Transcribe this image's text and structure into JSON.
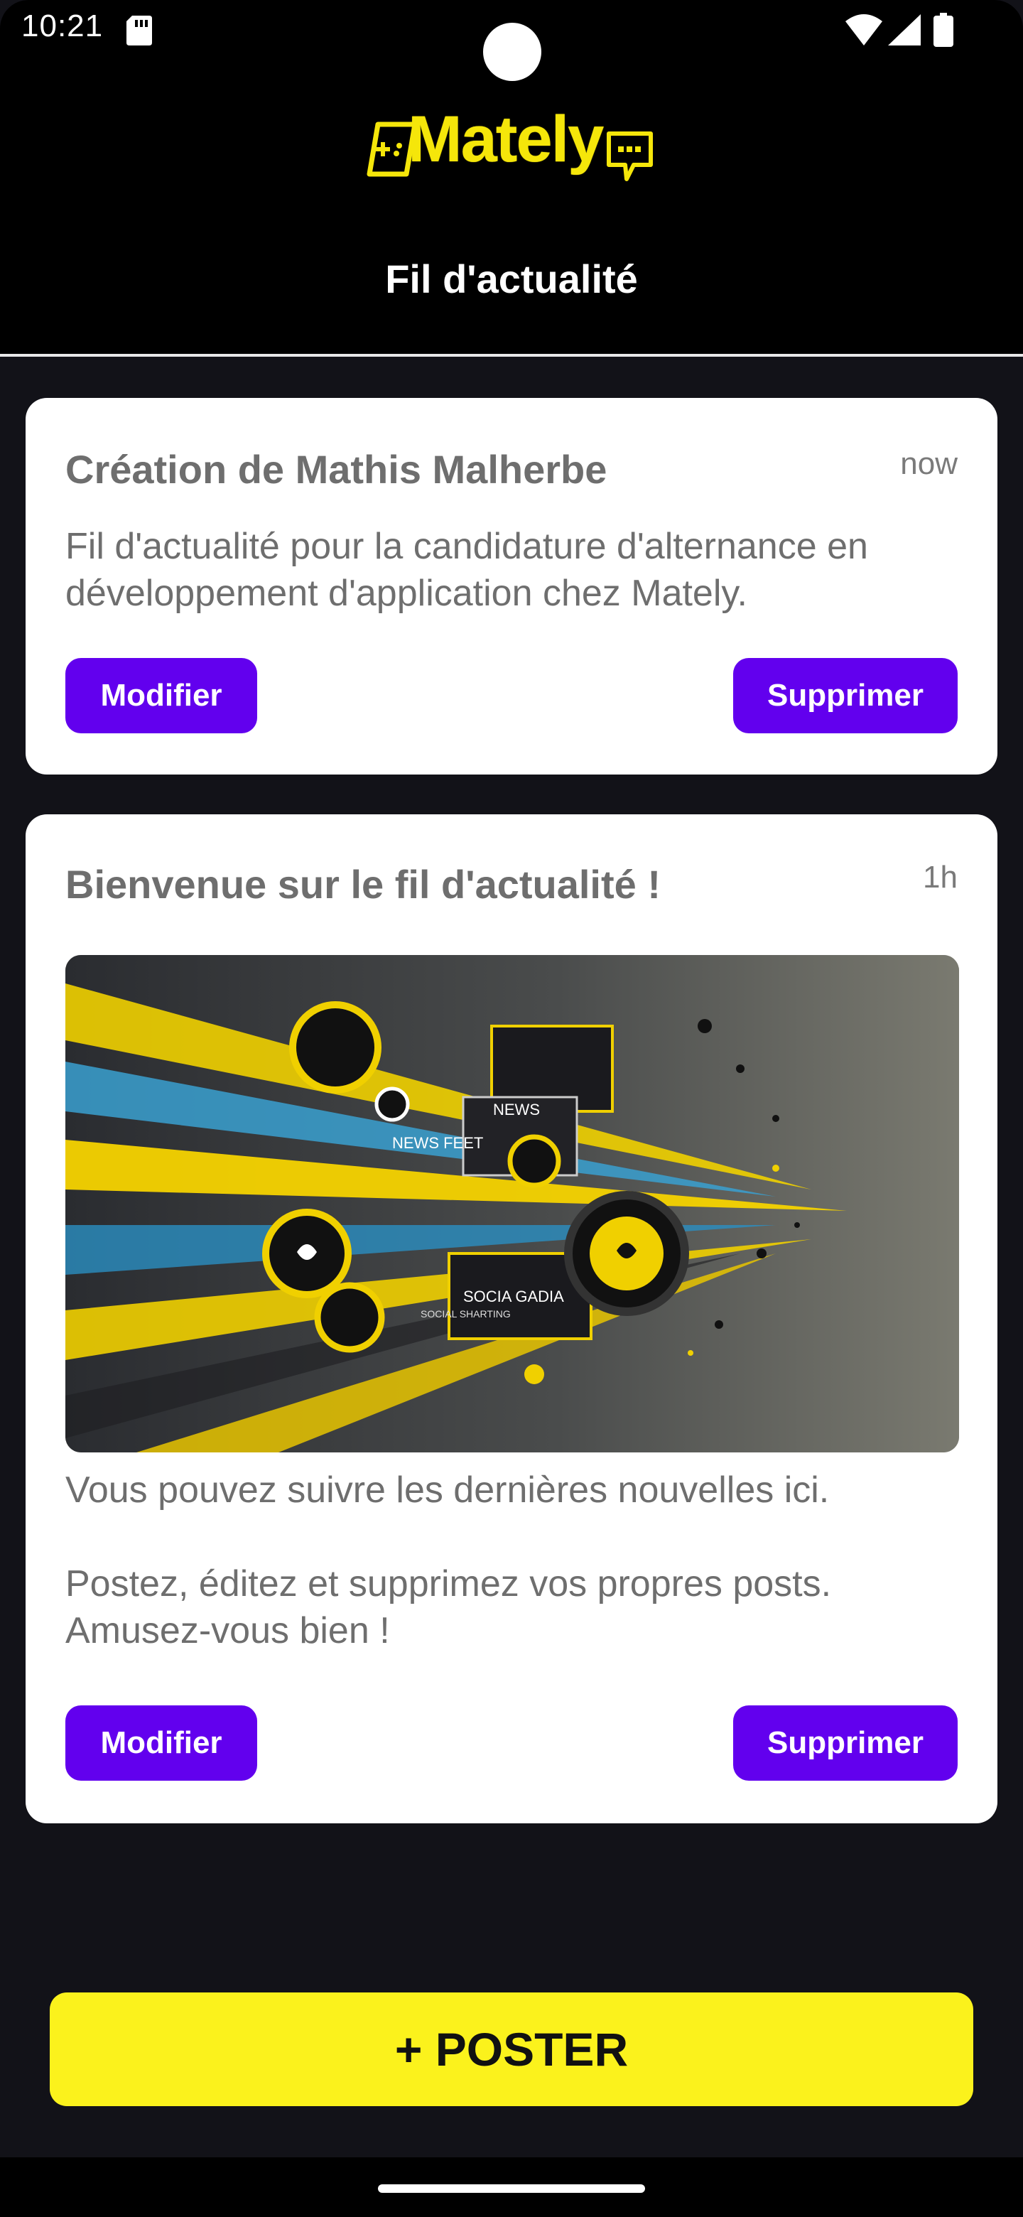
{
  "status_bar": {
    "time": "10:21",
    "icons": [
      "sd-card-icon",
      "wifi-icon",
      "signal-icon",
      "battery-icon"
    ]
  },
  "header": {
    "logo_text": "Mately",
    "title": "Fil d'actualité"
  },
  "posts": [
    {
      "title": "Création de Mathis Malherbe",
      "time": "now",
      "body": "Fil d'actualité pour la candidature d'alternance en développement d'application chez Mately.",
      "edit_label": "Modifier",
      "delete_label": "Supprimer"
    },
    {
      "title": "Bienvenue sur le fil d'actualité !",
      "time": "1h",
      "image_text": [
        "NEWS",
        "NEWS FEET",
        "SOCIA GADIA",
        "SOCIAL SHARTING"
      ],
      "body_line_1": "Vous pouvez suivre les dernières nouvelles ici.",
      "body_line_2": "Postez, éditez et supprimez vos propres posts. Amusez-vous bien !",
      "edit_label": "Modifier",
      "delete_label": "Supprimer"
    }
  ],
  "poster_button_label": "+ POSTER",
  "colors": {
    "background": "#121218",
    "accent_yellow": "#fbf21c",
    "button_purple": "#6200ee",
    "card_text": "#6e6e6e"
  }
}
